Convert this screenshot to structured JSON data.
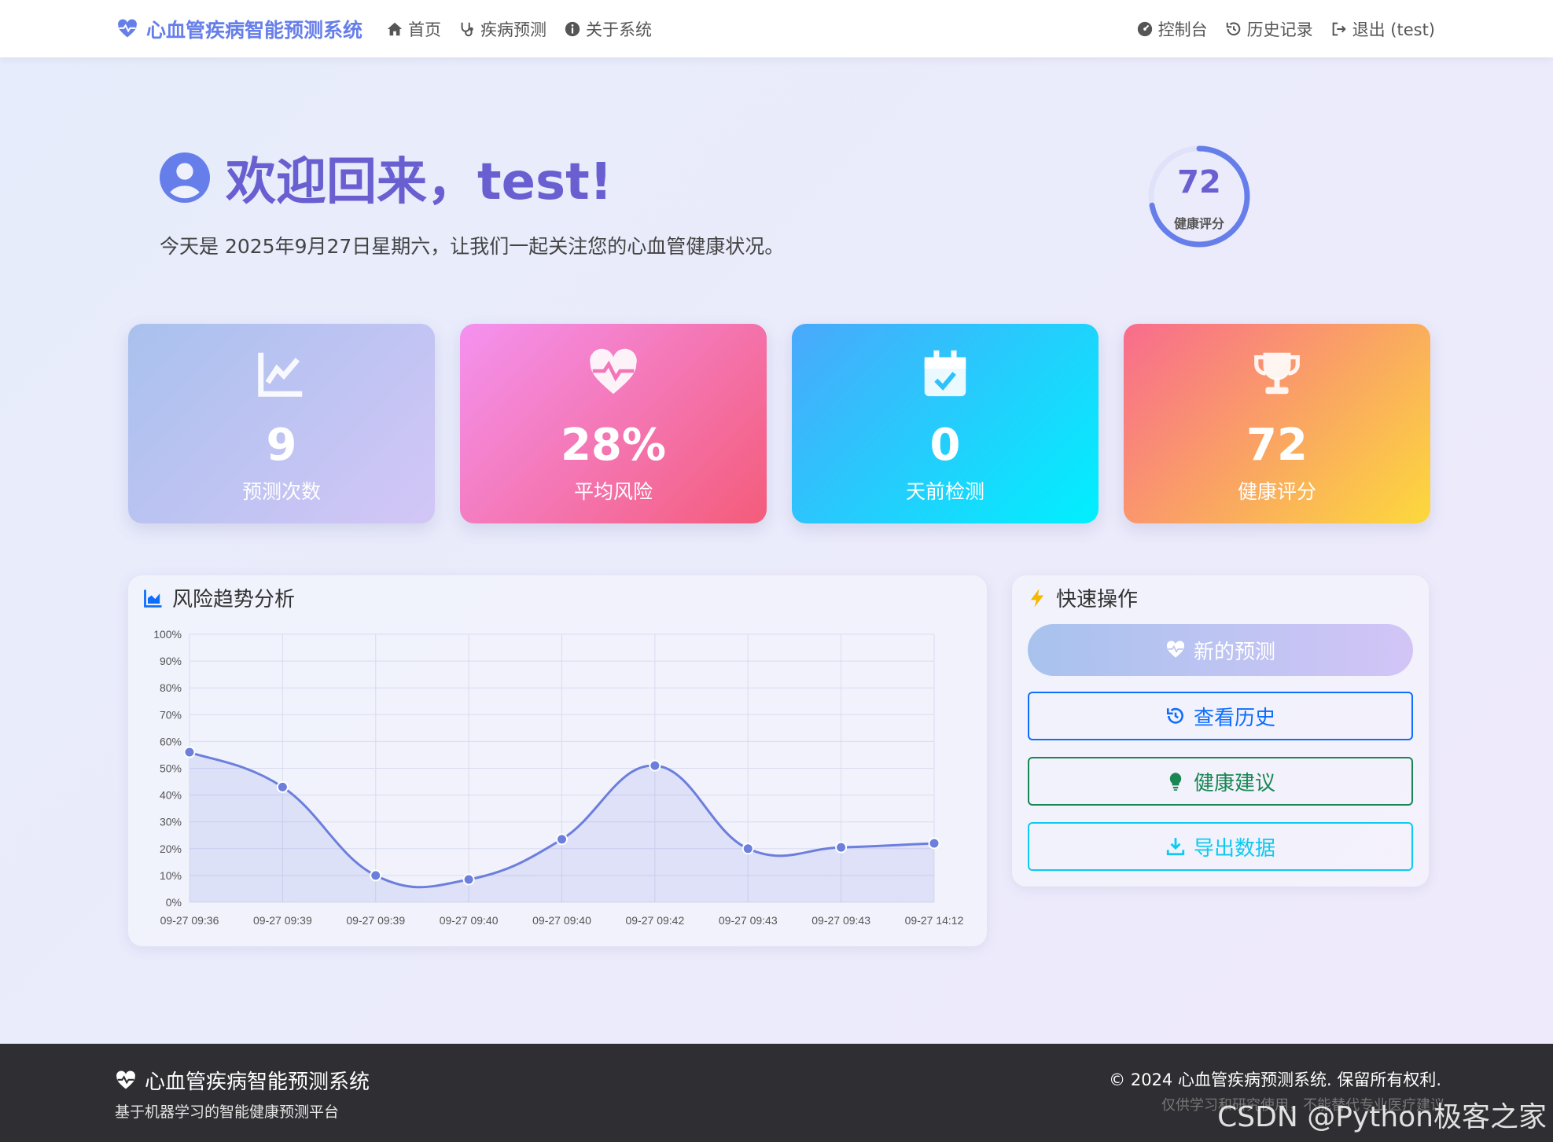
{
  "navbar": {
    "brand": "心血管疾病智能预测系统",
    "links": [
      {
        "label": "首页",
        "icon": "home-icon"
      },
      {
        "label": "疾病预测",
        "icon": "stethoscope-icon"
      },
      {
        "label": "关于系统",
        "icon": "info-icon"
      }
    ],
    "right": [
      {
        "label": "控制台",
        "icon": "dashboard-icon"
      },
      {
        "label": "历史记录",
        "icon": "history-icon"
      },
      {
        "label": "退出 (test)",
        "icon": "logout-icon"
      }
    ]
  },
  "welcome": {
    "title": "欢迎回来，test!",
    "subtitle": "今天是 2025年9月27日星期六，让我们一起关注您的心血管健康状况。"
  },
  "score_ring": {
    "value": "72",
    "label": "健康评分",
    "fraction": 0.72,
    "color": "#667eea"
  },
  "stats": [
    {
      "value": "9",
      "label": "预测次数",
      "icon": "chart-line-icon"
    },
    {
      "value": "28%",
      "label": "平均风险",
      "icon": "heart-pulse-icon"
    },
    {
      "value": "0",
      "label": "天前检测",
      "icon": "calendar-check-icon"
    },
    {
      "value": "72",
      "label": "健康评分",
      "icon": "trophy-icon"
    }
  ],
  "chart_card": {
    "title": "风险趋势分析"
  },
  "chart_data": {
    "type": "line",
    "title": "",
    "xlabel": "",
    "ylabel": "",
    "categories": [
      "09-27 09:36",
      "09-27 09:39",
      "09-27 09:39",
      "09-27 09:40",
      "09-27 09:40",
      "09-27 09:42",
      "09-27 09:43",
      "09-27 09:43",
      "09-27 14:12"
    ],
    "series": [
      {
        "values": [
          56,
          43,
          10,
          8.5,
          23.5,
          51,
          20,
          20.5,
          22
        ],
        "color": "#6c7fdc"
      }
    ],
    "ylim": [
      0,
      100
    ],
    "yticks": [
      "0%",
      "10%",
      "20%",
      "30%",
      "40%",
      "50%",
      "60%",
      "70%",
      "80%",
      "90%",
      "100%"
    ],
    "fill": true,
    "smooth": true,
    "grid": true,
    "legend": "none"
  },
  "quick": {
    "title": "快速操作",
    "buttons": [
      {
        "label": "新的预测",
        "icon": "heart-pulse-icon"
      },
      {
        "label": "查看历史",
        "icon": "history-icon"
      },
      {
        "label": "健康建议",
        "icon": "lightbulb-icon"
      },
      {
        "label": "导出数据",
        "icon": "download-icon"
      }
    ]
  },
  "footer": {
    "brand": "心血管疾病智能预测系统",
    "subtitle": "基于机器学习的智能健康预测平台",
    "copyright": "© 2024 心血管疾病预测系统. 保留所有权利.",
    "note": "仅供学习和研究使用，不能替代专业医疗建议",
    "watermark": "CSDN @Python极客之家"
  },
  "colors": {
    "primary": "#667eea",
    "brand_text": "#6a5fd1"
  }
}
